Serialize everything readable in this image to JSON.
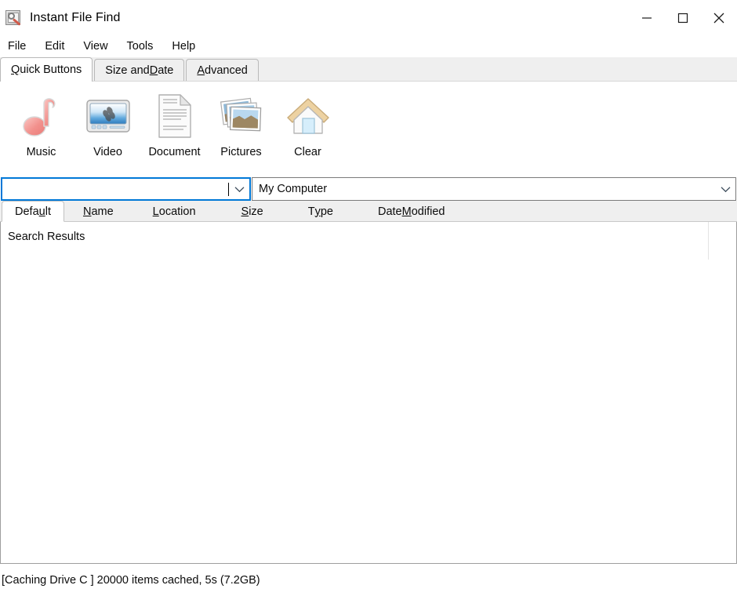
{
  "window": {
    "title": "Instant File Find",
    "icon": "magnifier-document-icon",
    "controls": {
      "minimize": "minimize-icon",
      "maximize": "maximize-icon",
      "close": "close-icon"
    }
  },
  "menubar": {
    "items": [
      {
        "label": "File"
      },
      {
        "label": "Edit"
      },
      {
        "label": "View"
      },
      {
        "label": "Tools"
      },
      {
        "label": "Help"
      }
    ]
  },
  "tabs": {
    "active_index": 0,
    "items": [
      {
        "label": "Quick Buttons",
        "mnemonic": "Q",
        "pre": "",
        "post": "uick Buttons"
      },
      {
        "label": "Size and Date",
        "mnemonic": "D",
        "pre": "Size and ",
        "post": "ate"
      },
      {
        "label": "Advanced",
        "mnemonic": "A",
        "pre": "",
        "post": "dvanced"
      }
    ]
  },
  "quick_buttons": [
    {
      "label": "Music",
      "icon": "music-note-icon"
    },
    {
      "label": "Video",
      "icon": "video-screen-icon"
    },
    {
      "label": "Document",
      "icon": "document-page-icon"
    },
    {
      "label": "Pictures",
      "icon": "photo-stack-icon"
    },
    {
      "label": "Clear",
      "icon": "house-icon"
    }
  ],
  "search": {
    "value": "",
    "placeholder": "",
    "focused": true,
    "dropdown_icon": "chevron-down-icon"
  },
  "scope": {
    "value": "My Computer",
    "dropdown_icon": "chevron-down-icon"
  },
  "columns": [
    {
      "label": "Default",
      "pre": "Defa",
      "mnemonic": "u",
      "post": "lt",
      "active": true
    },
    {
      "label": "Name",
      "pre": "",
      "mnemonic": "N",
      "post": "ame",
      "active": false
    },
    {
      "label": "Location",
      "pre": "",
      "mnemonic": "L",
      "post": "ocation",
      "active": false
    },
    {
      "label": "Size",
      "pre": "",
      "mnemonic": "S",
      "post": "ize",
      "active": false
    },
    {
      "label": "Type",
      "pre": "T",
      "mnemonic": "y",
      "post": "pe",
      "active": false
    },
    {
      "label": "Date Modified",
      "pre": "Date ",
      "mnemonic": "M",
      "post": "odified",
      "active": false
    }
  ],
  "results": {
    "label": "Search Results",
    "rows": []
  },
  "statusbar": {
    "text": "[Caching Drive C ] 20000 items cached,  5s (7.2GB)"
  },
  "colors": {
    "accent": "#0078d7",
    "chrome": "#efefef",
    "text": "#0b0b0b",
    "border": "#9e9e9e"
  }
}
